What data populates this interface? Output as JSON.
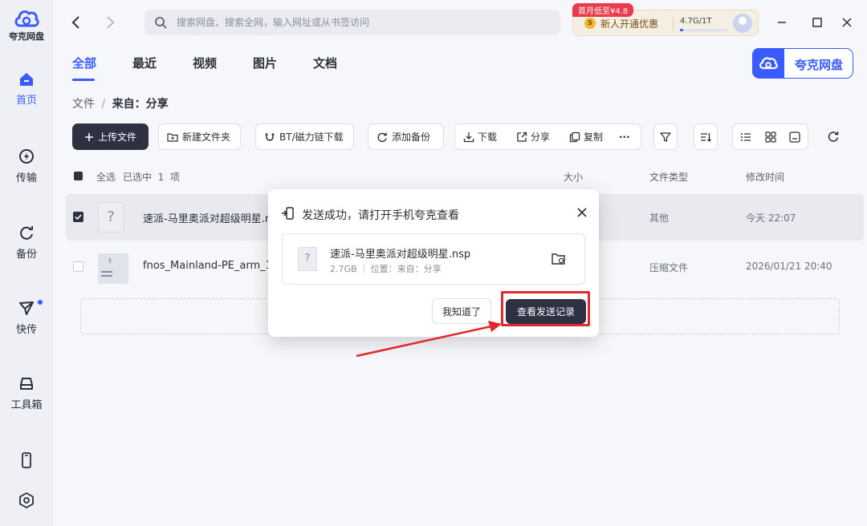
{
  "app": {
    "name": "夸克网盘"
  },
  "leftnav": {
    "items": [
      {
        "label": "首页",
        "icon": "home-icon",
        "active": true
      },
      {
        "label": "传输",
        "icon": "transfer-icon"
      },
      {
        "label": "备份",
        "icon": "backup-icon"
      },
      {
        "label": "快传",
        "icon": "send-icon"
      },
      {
        "label": "工具箱",
        "icon": "toolbox-icon"
      }
    ],
    "bottom_icons": [
      "phone-icon",
      "settings-icon"
    ]
  },
  "search": {
    "placeholder": "搜索网盘、搜索全网，输入网址或从书签访问"
  },
  "promo": {
    "tag": "首月低至¥4.8",
    "coin": "S",
    "text": "新人开通优惠",
    "storage": "4.7G/1T",
    "storage_used_fraction": 0.005
  },
  "tabs": [
    "全部",
    "最近",
    "视频",
    "图片",
    "文档"
  ],
  "brand_badge": "夸克网盘",
  "breadcrumb": {
    "root": "文件",
    "sep": "/",
    "current": "来自：分享"
  },
  "toolbar": {
    "upload": "上传文件",
    "new_folder": "新建文件夹",
    "bt_download": "BT/磁力链下载",
    "add_backup": "添加备份",
    "download": "下载",
    "share": "分享",
    "copy": "复制",
    "more": "···"
  },
  "table": {
    "select_all": "全选",
    "selected_info": "已选中  1  项",
    "headers": {
      "size": "大小",
      "type": "文件类型",
      "modified": "修改时间"
    },
    "rows": [
      {
        "name": "速派-马里奥派对超级明星.nsp",
        "size": "",
        "type": "其他",
        "modified": "今天 22:07",
        "selected": true
      },
      {
        "name": "fnos_Mainland-PE_arm_1.0",
        "size": "",
        "type": "压缩文件",
        "modified": "2026/01/21 20:40",
        "selected": false
      }
    ]
  },
  "modal": {
    "title": "发送成功，请打开手机夸克查看",
    "file_name": "速派-马里奥派对超级明星.nsp",
    "file_size": "2.7GB",
    "location": "位置：来自：分享",
    "cancel": "我知道了",
    "confirm": "查看发送记录"
  },
  "colors": {
    "accent": "#3a5cff",
    "dark_button": "#2d3142",
    "annotation": "#e0282e",
    "promo_tag": "#ea3a4c"
  }
}
